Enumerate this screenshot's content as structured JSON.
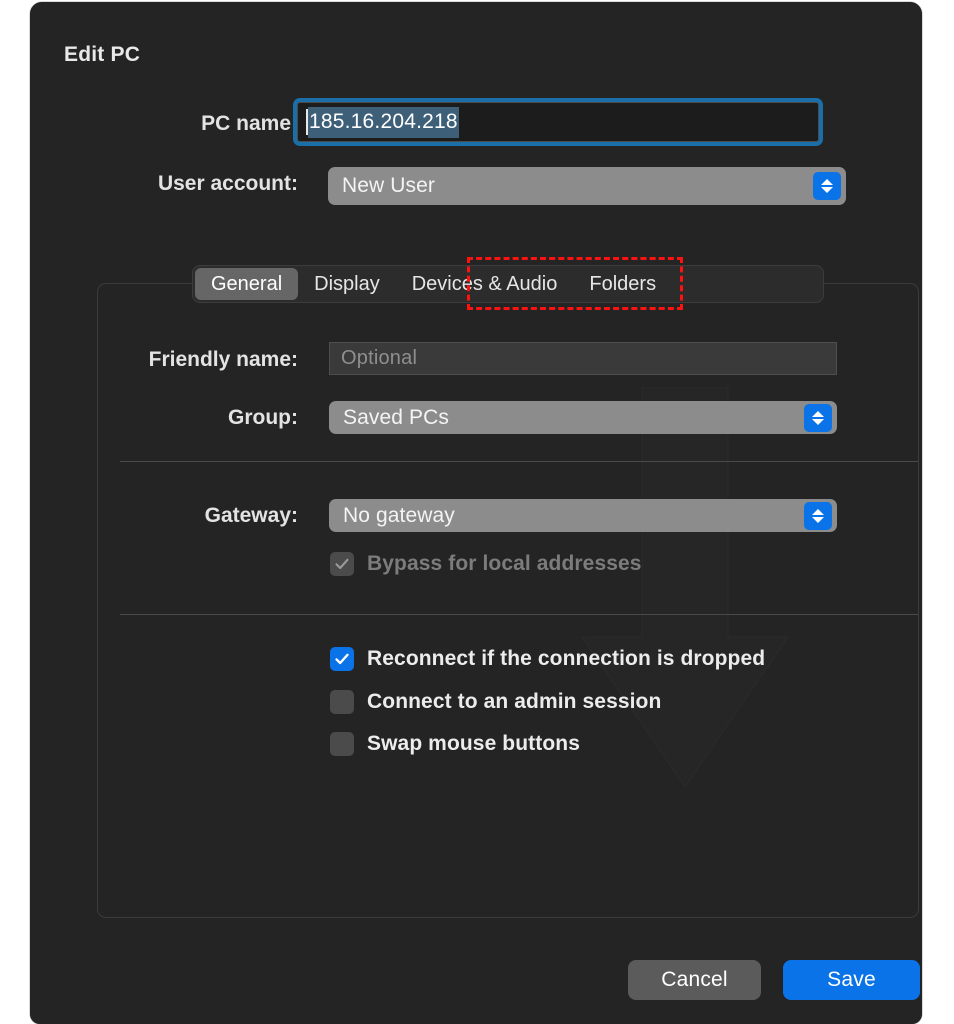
{
  "dialog": {
    "title": "Edit PC"
  },
  "top_form": {
    "pc_name": {
      "label": "PC name:",
      "value": "185.16.204.218",
      "selected": true,
      "focused": true
    },
    "user_account": {
      "label": "User account:",
      "value": "New User"
    }
  },
  "tabs": [
    {
      "label": "General",
      "selected": true
    },
    {
      "label": "Display",
      "selected": false
    },
    {
      "label": "Devices & Audio",
      "selected": false,
      "highlighted": true
    },
    {
      "label": "Folders",
      "selected": false
    }
  ],
  "general_tab": {
    "friendly_name": {
      "label": "Friendly name:",
      "value": "",
      "placeholder": "Optional"
    },
    "group": {
      "label": "Group:",
      "value": "Saved PCs"
    },
    "gateway": {
      "label": "Gateway:",
      "value": "No gateway"
    },
    "bypass": {
      "label": "Bypass for local addresses",
      "checked": true,
      "disabled": true
    },
    "options": [
      {
        "label": "Reconnect if the connection is dropped",
        "checked": true
      },
      {
        "label": "Connect to an admin session",
        "checked": false
      },
      {
        "label": "Swap mouse buttons",
        "checked": false
      }
    ]
  },
  "footer": {
    "cancel_label": "Cancel",
    "save_label": "Save"
  },
  "colors": {
    "accent_blue": "#0b73e8",
    "focus_ring": "#1b6fa8",
    "highlight_red": "#fe1111",
    "dialog_background": "#242424",
    "popup_background": "#8c8c8c"
  },
  "icons": {
    "stepper": "up-down-chevron-icon",
    "checkmark": "check-icon"
  }
}
